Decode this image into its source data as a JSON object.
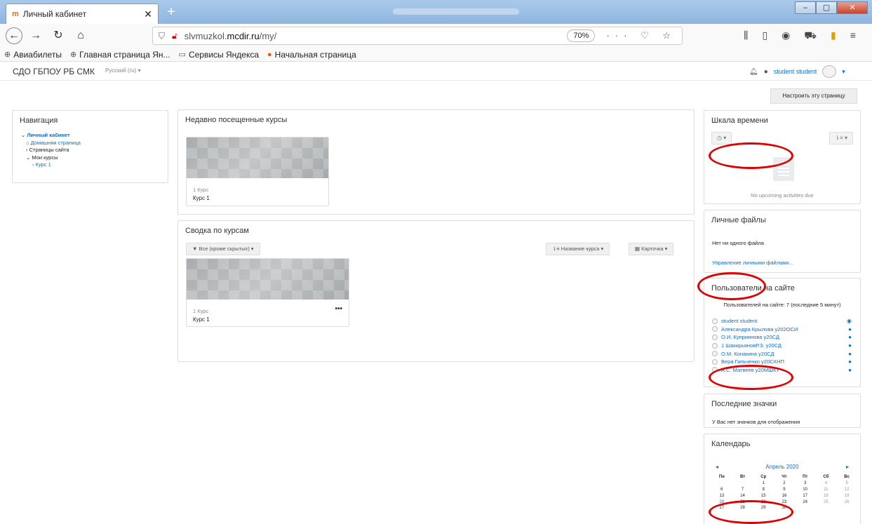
{
  "browser": {
    "tab_title": "Личный кабинет",
    "url_host_prefix": "slvmuzkol.",
    "url_host_main": "mcdir.ru",
    "url_path": "/my/",
    "zoom": "70%",
    "bookmarks": [
      "Авиабилеты",
      "Главная страница Ян...",
      "Сервисы Яндекса",
      "Начальная страница"
    ]
  },
  "site": {
    "brand": "СДО ГБПОУ РБ СМК",
    "language": "Русский (ru) ▾",
    "user_name": "student student",
    "customize_button": "Настроить эту страницу"
  },
  "navigation": {
    "title": "Навигация",
    "items": [
      "Личный кабинет",
      "Домашняя страница",
      "Страницы сайта",
      "Мои курсы",
      "Курс 1"
    ]
  },
  "recent": {
    "title": "Недавно посещенные курсы",
    "course_category": "1 Курс",
    "course_name": "Курс 1"
  },
  "overview": {
    "title": "Сводка по курсам",
    "filter": "Все (кроме скрытых) ▾",
    "sort": "Название курса ▾",
    "view": "Карточка ▾",
    "course_category": "1 Курс",
    "course_name": "Курс 1",
    "menu": "•••"
  },
  "timeline": {
    "title": "Шкала времени",
    "btn_left": "◷ ▾",
    "btn_right": "⇂≡ ▾",
    "empty": "No upcoming activities due"
  },
  "files": {
    "title": "Личные файлы",
    "empty": "Нет ни одного файла",
    "manage_link": "Управление личными файлами..."
  },
  "online": {
    "title": "Пользователи на сайте",
    "info": "Пользователей на сайте: 7 (последние 5 минут)",
    "users": [
      "student student",
      "Александра Крылова у202ОСИ",
      "О.И. Куприянова у20СД",
      "1 ШакирьяновР.З. у20СД",
      "О.М. Конакина у20СД",
      "Вера Гильченко у20СХНП",
      "А.С. Матвеев у20МШКТ"
    ]
  },
  "badges": {
    "title": "Последние значки",
    "empty": "У Вас нет значков для отображения"
  },
  "calendar": {
    "title": "Календарь",
    "month": "Апрель 2020",
    "prev": "◂",
    "next": "▸",
    "weekdays": [
      "Пн",
      "Вт",
      "Ср",
      "Чт",
      "Пт",
      "Сб",
      "Вс"
    ],
    "weeks": [
      [
        "",
        "",
        "1",
        "2",
        "3",
        "4",
        "5"
      ],
      [
        "6",
        "7",
        "8",
        "9",
        "10",
        "11",
        "12"
      ],
      [
        "13",
        "14",
        "15",
        "16",
        "17",
        "18",
        "19"
      ],
      [
        "20",
        "21",
        "22",
        "23",
        "24",
        "25",
        "26"
      ],
      [
        "27",
        "28",
        "29",
        "30",
        "",
        "",
        ""
      ]
    ]
  }
}
